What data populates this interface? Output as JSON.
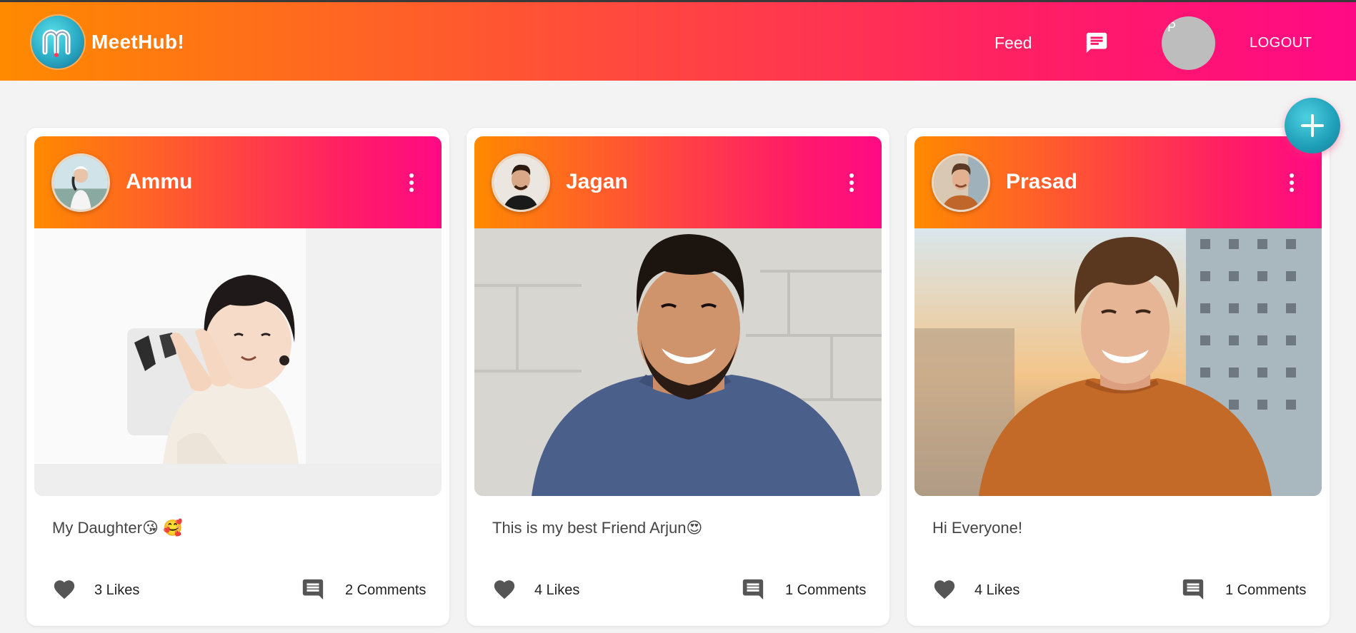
{
  "app": {
    "name": "MeetHub!",
    "brand_gradient": [
      "#ff8a00",
      "#ff0a85"
    ],
    "accent_fab": "#1f9fb8"
  },
  "nav": {
    "feed_label": "Feed",
    "chat_icon": "chat-icon",
    "avatar_initial": "P",
    "logout_label": "LOGOUT"
  },
  "fab": {
    "icon": "plus-icon"
  },
  "posts": [
    {
      "author": "Ammu",
      "caption": "My Daughter😘 🥰",
      "likes": "3 Likes",
      "comments": "2 Comments",
      "image": "photo-baby-clapping"
    },
    {
      "author": "Jagan",
      "caption": "This is my best Friend Arjun😍",
      "likes": "4 Likes",
      "comments": "1 Comments",
      "image": "photo-man-blue-shirt"
    },
    {
      "author": "Prasad",
      "caption": "Hi Everyone!",
      "likes": "4 Likes",
      "comments": "1 Comments",
      "image": "photo-man-orange-sweater"
    }
  ]
}
